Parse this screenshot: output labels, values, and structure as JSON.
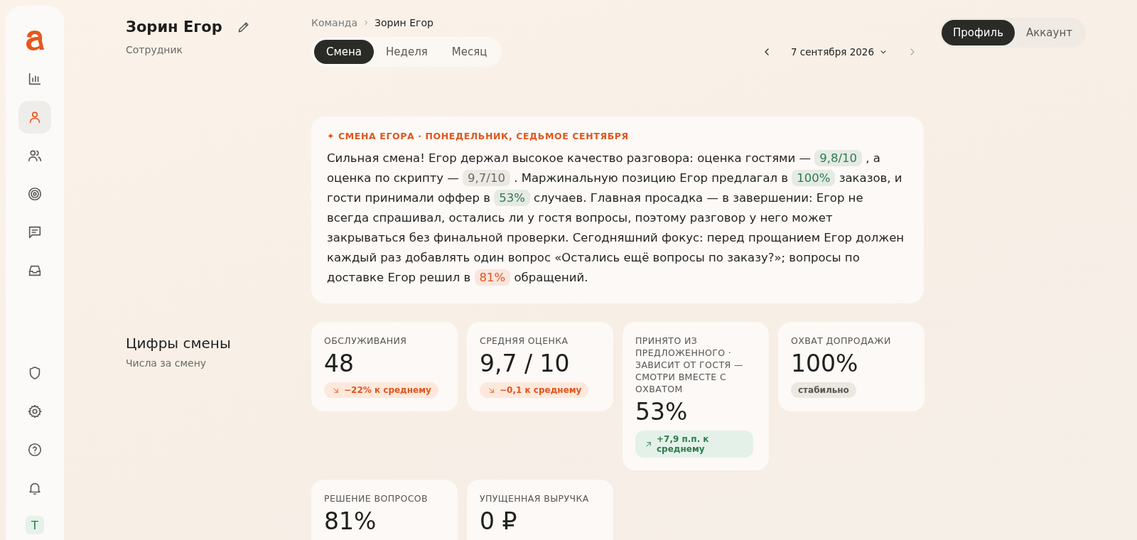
{
  "sidebar": {
    "top": [
      {
        "selected": false
      },
      {
        "selected": true
      },
      {
        "selected": false
      },
      {
        "selected": false
      },
      {
        "selected": false
      },
      {
        "selected": false
      }
    ],
    "bottom": [
      {
        "selected": false
      },
      {
        "selected": false
      },
      {
        "selected": false
      },
      {
        "selected": false
      }
    ],
    "avatar": {
      "initial": "Т"
    }
  },
  "header": {
    "name": "Зорин Егор",
    "role": "Сотрудник"
  },
  "breadcrumb": [
    {
      "label": "Команда",
      "current": false
    },
    {
      "label": "Зорин Егор",
      "current": true
    }
  ],
  "period_tabs": [
    {
      "label": "Смена",
      "selected": true
    },
    {
      "label": "Неделя",
      "selected": false
    },
    {
      "label": "Месяц",
      "selected": false
    }
  ],
  "date_nav": {
    "date": "7 сентября 2026",
    "next_disabled": true
  },
  "view_toggle": [
    {
      "label": "Профиль",
      "selected": true
    },
    {
      "label": "Аккаунт",
      "selected": false
    }
  ],
  "summary": {
    "eyebrow": "✦ СМЕНА ЕГОРА · ПОНЕДЕЛЬНИК, СЕДЬМОЕ СЕНТЯБРЯ",
    "parts": [
      {
        "text": "Сильная смена! Егор держал высокое качество разговора: оценка гостями — "
      },
      {
        "text": "9,8/10",
        "color": "#2f7a4e"
      },
      {
        "text": " , а оценка по скрипту — "
      },
      {
        "text": "9,7/10",
        "color": "#6b6a5e"
      },
      {
        "text": " . Маржинальную позицию Егор предлагал в "
      },
      {
        "text": "100%",
        "color": "#2f7a4e"
      },
      {
        "text": " заказов, и гости принимали оффер в "
      },
      {
        "text": "53%",
        "color": "#2f7a4e"
      },
      {
        "text": " случаев. Главная просадка — в завершении: Егор не всегда спрашивал, остались ли у гостя вопросы, поэтому разговор у него может закрываться без финальной проверки. Сегодняшний фокус: перед прощанием Егор должен каждый раз добавлять один вопрос «Остались ещё вопросы по заказу?»; вопросы по доставке Егор решил в "
      },
      {
        "text": "81%",
        "color": "#e0541c"
      },
      {
        "text": " обращений."
      }
    ]
  },
  "stats_section": {
    "title": "Цифры смены",
    "subtitle": "Числа за смену"
  },
  "stats": [
    {
      "label": "ОБСЛУЖИВАНИЯ",
      "value": "48",
      "delta": {
        "text": "−22% к среднему",
        "kind": "down"
      }
    },
    {
      "label": "СРЕДНЯЯ ОЦЕНКА",
      "value": "9,7 / 10",
      "delta": {
        "text": "−0,1 к среднему",
        "kind": "down"
      }
    },
    {
      "label": "ПРИНЯТО ИЗ ПРЕДЛОЖЕННОГО · ЗАВИСИТ ОТ ГОСТЯ — СМОТРИ ВМЕСТЕ С ОХВАТОМ",
      "value": "53%",
      "delta": {
        "text": "+7,9 п.п. к среднему",
        "kind": "up"
      }
    },
    {
      "label": "ОХВАТ ДОПРОДАЖИ",
      "value": "100%",
      "delta": {
        "text": "стабильно",
        "kind": "flat"
      }
    },
    {
      "label": "РЕШЕНИЕ ВОПРОСОВ",
      "value": "81%"
    },
    {
      "label": "УПУЩЕННАЯ ВЫРУЧКА",
      "value": "0 ₽"
    }
  ]
}
